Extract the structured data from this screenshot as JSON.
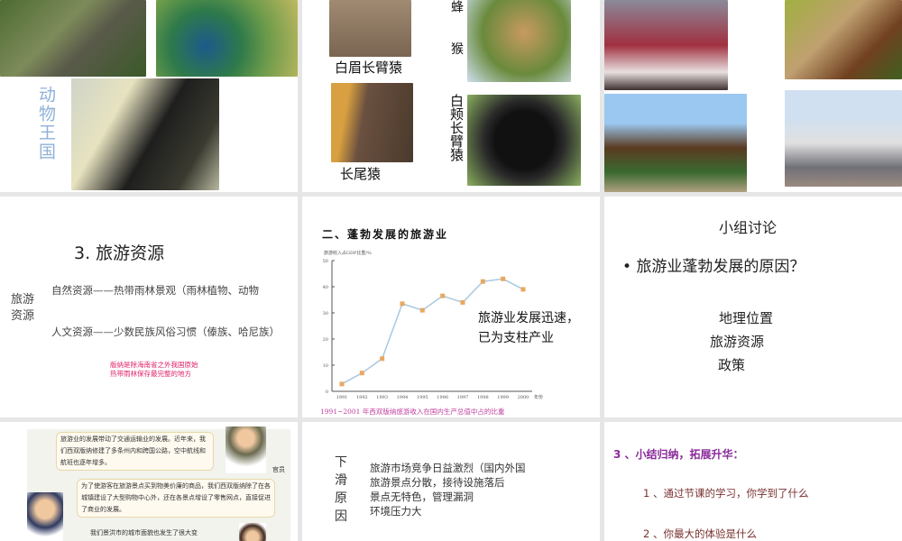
{
  "slides": [
    {
      "title": "动物王国"
    },
    {
      "labels": {
        "gibbon_white_brow": "白眉长臂猿",
        "loris": "蜂 猴",
        "long_tail": "长尾猿",
        "white_cheek": "白颊长臂猿"
      }
    },
    {},
    {
      "title": "3. 旅游资源",
      "side": "旅游资源",
      "natural": "自然资源——热带雨林景观（雨林植物、动物",
      "cultural": "人文资源——少数民族风俗习惯（傣族、哈尼族）",
      "note1": "版纳是除海南省之外我国原始",
      "note2": "热带雨林保存最完整的地方"
    },
    {
      "heading": "二、蓬勃发展的旅游业",
      "callout1": "旅游业发展迅速，",
      "callout2": "已为支柱产业"
    },
    {
      "title": "小组讨论",
      "bullet": "旅游业蓬勃发展的原因？",
      "items": [
        "地理位置",
        "旅游资源",
        "政策"
      ]
    },
    {
      "bubble1": "旅游业的发展带动了交通运输业的发展。近年来，我们西双版纳修建了多条州内和跨国公路，空中航线和航班也逐年增多。",
      "role": "官员",
      "bubble2": "为了使游客在旅游景点买到物美价廉的商品，我们西双版纳除了在各城镇建设了大型购物中心外，还在各景点增设了零售网点，直接促进了商业的发展。",
      "bubble3": "我们景洪市的城市面貌也发生了很大变"
    },
    {
      "side": "下滑原因",
      "items": [
        "旅游市场竞争日益激烈（国内外国",
        "旅游景点分散，接待设施落后",
        "景点无特色，管理漏洞",
        "环境压力大"
      ]
    },
    {
      "heading": "3 、小结归纳，拓展升华：",
      "q1": "1 、通过节课的学习，你学到了什么",
      "q2": "2 、你最大的体验是什么"
    }
  ],
  "chart_data": {
    "type": "line",
    "title": "1991~2001 年西双版纳旅游收入在国内生产总值中占的比重",
    "ylabel": "旅游收入占GDP比重/%",
    "xlabel": "年份",
    "categories": [
      "1991",
      "1992",
      "1993",
      "1994",
      "1995",
      "1996",
      "1997",
      "1998",
      "1999",
      "2000"
    ],
    "values": [
      2.8,
      7,
      12.5,
      33.5,
      31,
      36.5,
      34,
      42,
      43,
      39
    ],
    "yticks": [
      "0",
      "10",
      "20",
      "30",
      "40",
      "50"
    ],
    "ylim": [
      0,
      50
    ],
    "line_color": "#a9c8e0",
    "marker_color": "#e8a860"
  }
}
